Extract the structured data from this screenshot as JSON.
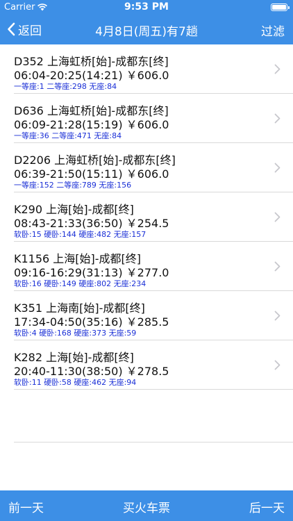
{
  "status_bar": {
    "carrier": "Carrier",
    "time": "9:53 PM"
  },
  "nav": {
    "back_label": "返回",
    "title": "4月8日(周五)有7趟",
    "filter_label": "过滤"
  },
  "trains": [
    {
      "line1": "D352 上海虹桥[始]-成都东[终]",
      "line2": "06:04-20:25(14:21) ￥606.0",
      "line3": "一等座:1 二等座:298 无座:84"
    },
    {
      "line1": "D636 上海虹桥[始]-成都东[终]",
      "line2": "06:09-21:28(15:19) ￥606.0",
      "line3": "一等座:36 二等座:471 无座:84"
    },
    {
      "line1": "D2206 上海虹桥[始]-成都东[终]",
      "line2": "06:39-21:50(15:11) ￥606.0",
      "line3": "一等座:152 二等座:789 无座:156"
    },
    {
      "line1": "K290 上海[始]-成都[终]",
      "line2": "08:43-21:33(36:50) ￥254.5",
      "line3": "软卧:15 硬卧:144 硬座:482 无座:157"
    },
    {
      "line1": "K1156 上海[始]-成都[终]",
      "line2": "09:16-16:29(31:13) ￥277.0",
      "line3": "软卧:16 硬卧:149 硬座:802 无座:234"
    },
    {
      "line1": "K351 上海南[始]-成都[终]",
      "line2": "17:34-04:50(35:16) ￥285.5",
      "line3": "软卧:4 硬卧:168 硬座:373 无座:59"
    },
    {
      "line1": "K282 上海[始]-成都[终]",
      "line2": "20:40-11:30(38:50) ￥278.5",
      "line3": "软卧:11 硬卧:58 硬座:462 无座:94"
    }
  ],
  "bottom": {
    "prev_label": "前一天",
    "buy_label": "买火车票",
    "next_label": "后一天"
  },
  "colors": {
    "bar": "#3d8fe6",
    "seat_text": "#1a2fd6"
  }
}
